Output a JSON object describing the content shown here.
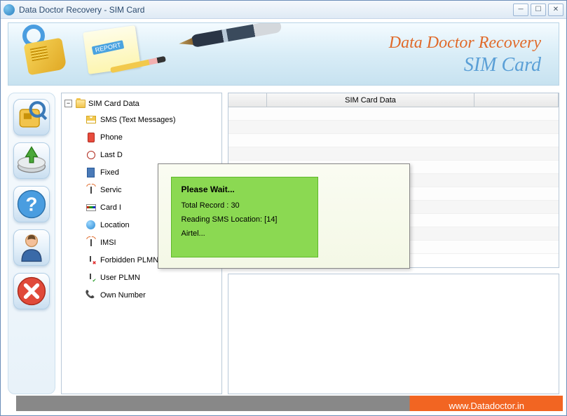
{
  "window": {
    "title": "Data Doctor Recovery - SIM Card"
  },
  "header": {
    "line1": "Data Doctor Recovery",
    "line2": "SIM Card",
    "report_tag": "REPORT"
  },
  "sidebar": {
    "scan": "scan-sim",
    "save": "save-drive",
    "help": "help",
    "user": "user",
    "close": "close"
  },
  "tree": {
    "root": "SIM Card Data",
    "items": [
      {
        "label": "SMS (Text Messages)",
        "icon": "envelope"
      },
      {
        "label": "Phone",
        "icon": "phone"
      },
      {
        "label": "Last D",
        "icon": "clock"
      },
      {
        "label": "Fixed",
        "icon": "calc"
      },
      {
        "label": "Servic",
        "icon": "antenna"
      },
      {
        "label": "Card I",
        "icon": "card"
      },
      {
        "label": "Location",
        "icon": "globe"
      },
      {
        "label": "IMSI",
        "icon": "antenna"
      },
      {
        "label": "Forbidden PLMN",
        "icon": "plmn"
      },
      {
        "label": "User PLMN",
        "icon": "uplmn"
      },
      {
        "label": "Own Number",
        "icon": "own"
      }
    ]
  },
  "grid": {
    "header": "SIM Card Data"
  },
  "modal": {
    "title": "Please Wait...",
    "total_label": "Total Record :",
    "total_value": "30",
    "reading_prefix": "Reading SMS Location:",
    "reading_loc": "[14]",
    "provider": "Airtel..."
  },
  "footer": {
    "url": "www.Datadoctor.in"
  }
}
